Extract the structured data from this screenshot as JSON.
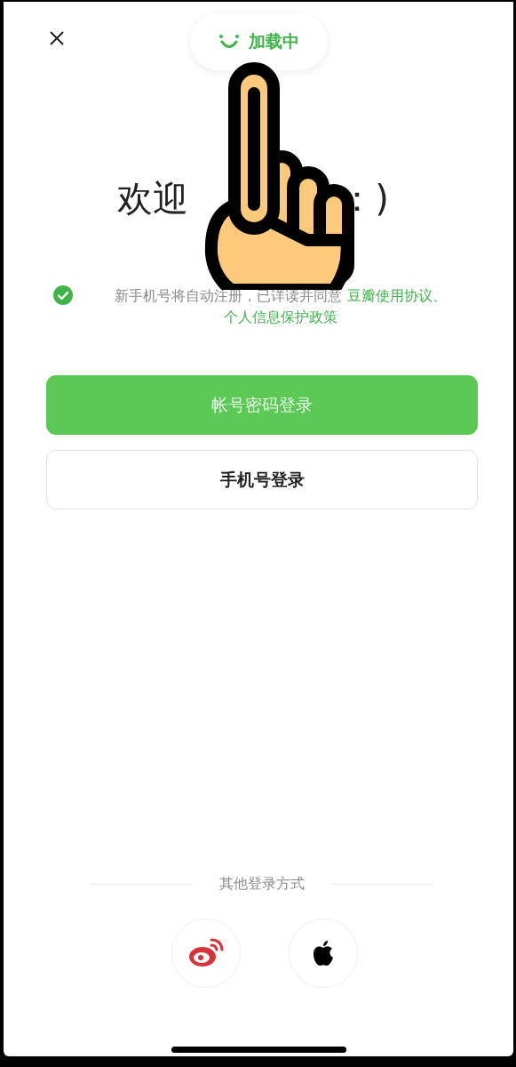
{
  "loading_toast": {
    "text": "加载中"
  },
  "title_parts": [
    "欢迎",
    "：)"
  ],
  "consent": {
    "checked": true,
    "text": "新手机号将自动注册，已详读并同意 ",
    "links": [
      "豆瓣使用协议、",
      "个人信息保护政策"
    ]
  },
  "buttons": [
    {
      "label": "帐号密码登录",
      "kind": "primary"
    },
    {
      "label": "手机号登录",
      "kind": "secondary"
    }
  ],
  "other_login": {
    "label": "其他登录方式",
    "providers": [
      {
        "kind": "weibo"
      },
      {
        "kind": "apple"
      }
    ]
  }
}
